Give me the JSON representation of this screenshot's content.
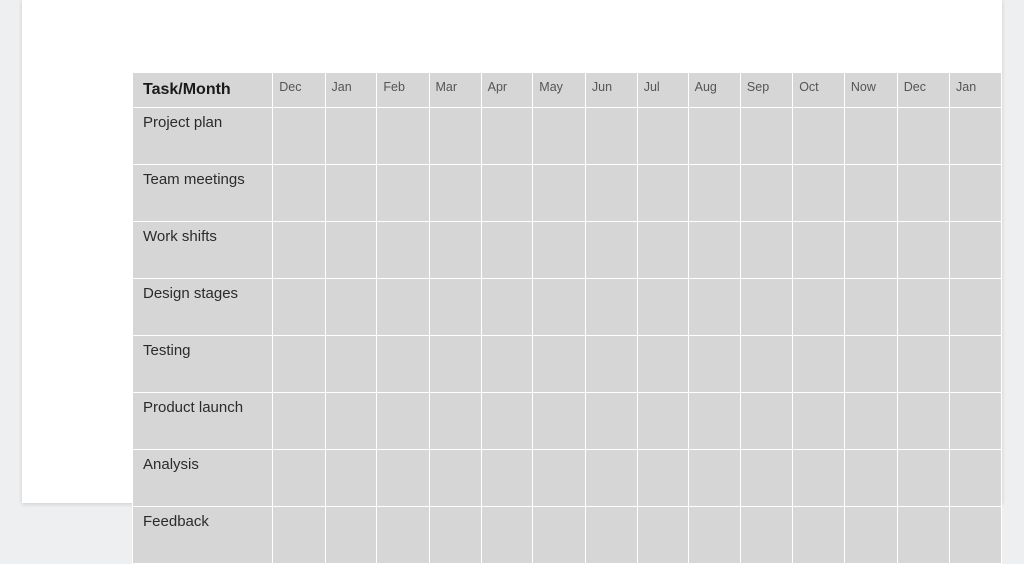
{
  "table": {
    "header_label": "Task/Month",
    "months": [
      "Dec",
      "Jan",
      "Feb",
      "Mar",
      "Apr",
      "May",
      "Jun",
      "Jul",
      "Aug",
      "Sep",
      "Oct",
      "Now",
      "Dec",
      "Jan"
    ],
    "tasks": [
      "Project plan",
      "Team meetings",
      "Work shifts",
      "Design stages",
      "Testing",
      "Product launch",
      "Analysis",
      "Feedback"
    ]
  }
}
